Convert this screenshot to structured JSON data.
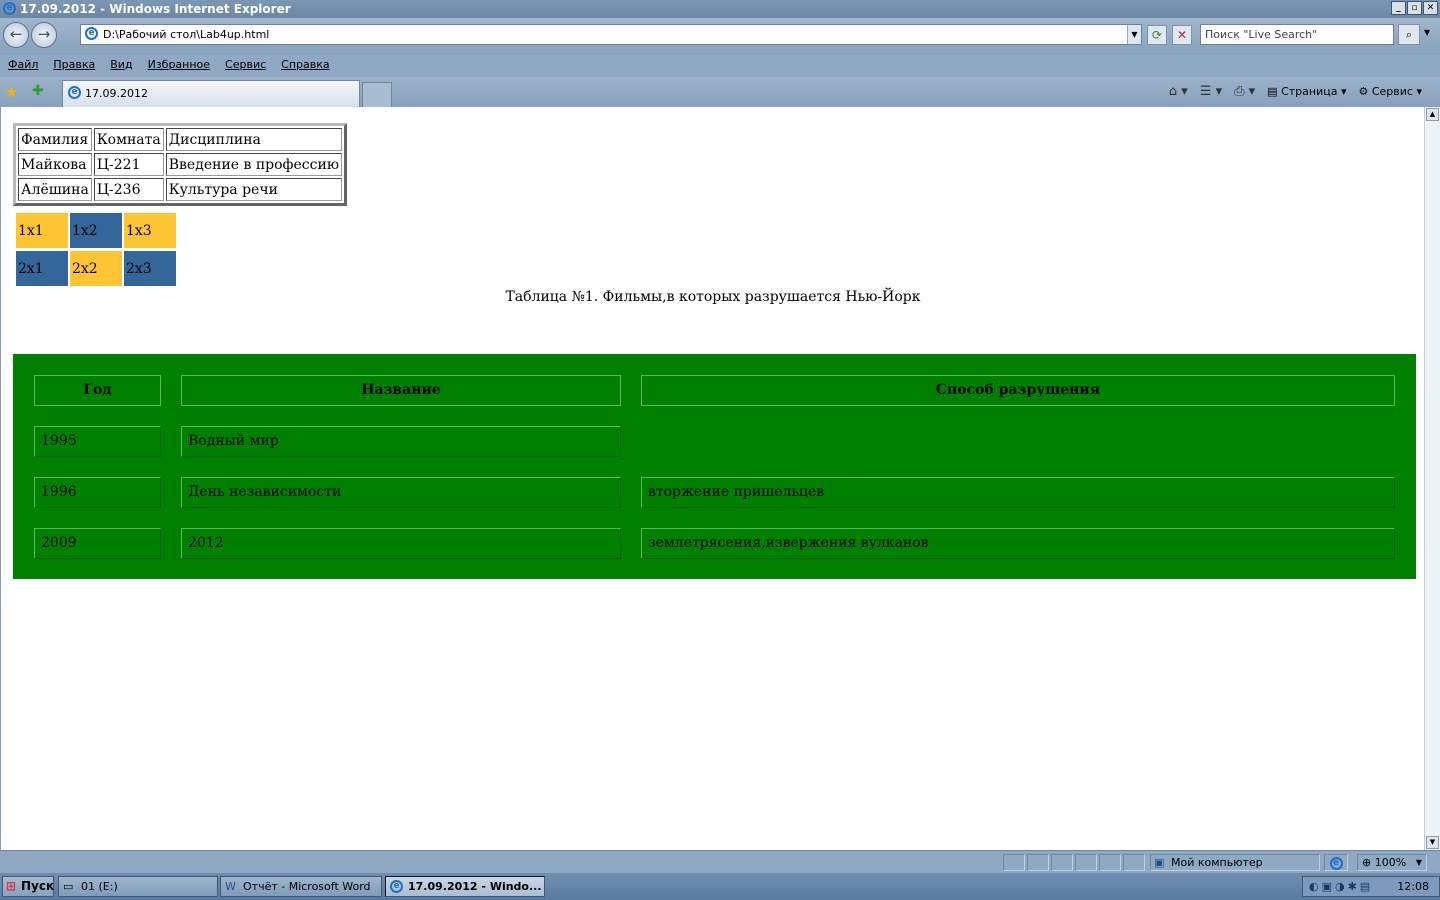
{
  "window": {
    "title": "17.09.2012 - Windows Internet Explorer"
  },
  "address_bar": {
    "url": "D:\\Рабочий стол\\Lab4up.html",
    "search_placeholder": "Поиск \"Live Search\""
  },
  "menu": [
    "Файл",
    "Правка",
    "Вид",
    "Избранное",
    "Сервис",
    "Справка"
  ],
  "tab": {
    "label": "17.09.2012"
  },
  "command_bar": {
    "page_label": "Страница",
    "tools_label": "Сервис"
  },
  "page": {
    "table1": {
      "rows": [
        [
          "Фамилия",
          "Комната",
          "Дисциплина"
        ],
        [
          "Майкова",
          "Ц-221",
          "Введение в профессию"
        ],
        [
          "Алёшина",
          "Ц-236",
          "Культура речи"
        ]
      ]
    },
    "grid": {
      "rows": [
        [
          "1x1",
          "1x2",
          "1x3"
        ],
        [
          "2x1",
          "2x2",
          "2x3"
        ]
      ],
      "colors": {
        "yellow": "#ffc533",
        "blue": "#336699"
      }
    },
    "caption": "Таблица №1. Фильмы,в которых разрушается Нью-Йорк",
    "films": {
      "headers": [
        "Год",
        "Название",
        "Способ разрушения"
      ],
      "rows": [
        [
          "1995",
          "Водный мир",
          ""
        ],
        [
          "1996",
          "День независимости",
          "вторжение пришельцев"
        ],
        [
          "2009",
          "2012",
          "землетрясения,извержения вулканов"
        ]
      ],
      "background": "#008000"
    }
  },
  "status_bar": {
    "zone": "Мой компьютер",
    "zoom": "100%"
  },
  "taskbar": {
    "start": "Пуск",
    "tasks": [
      "01 (E:)",
      "Отчёт - Microsoft Word",
      "17.09.2012 - Windo..."
    ],
    "clock": "12:08"
  }
}
